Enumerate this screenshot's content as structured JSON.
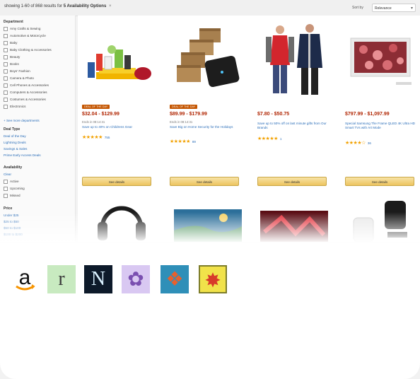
{
  "header": {
    "results_text": "showing 1-60 of 868 results for",
    "results_bold": "5 Availability Options",
    "sort_label": "Sort by",
    "sort_value": "Relevance"
  },
  "sidebar": {
    "department_heading": "Department",
    "departments": [
      "Amy Crafts & Sewing",
      "Automotive & Motorcycle",
      "Baby",
      "Baby Clothing & Accessories",
      "Beauty",
      "Books",
      "Boys' Fashion",
      "Camera & Photo",
      "Cell Phones & Accessories",
      "Computers & Accessories",
      "Costumes & Accessories",
      "Electronics"
    ],
    "see_more": "+ See more departments",
    "deal_type_heading": "Deal Type",
    "deal_types": [
      "Deal of the Day",
      "Lightning Deals",
      "Savings & Sales",
      "Prime Early Access Deals"
    ],
    "availability_heading": "Availability",
    "availability_clear": "Clear",
    "availability": [
      "Active",
      "Upcoming",
      "Missed"
    ],
    "price_heading": "Price",
    "prices": [
      "Under $25",
      "$25 to $50",
      "$50 to $100",
      "$100 to $200"
    ]
  },
  "products": [
    {
      "badge": "DEAL OF THE DAY",
      "price": "$32.04 - $129.99",
      "sub": "Ends in 08:14:31",
      "title": "Save up to 40% on Childrens Gear",
      "stars": "★★★★★",
      "rating_count": "755",
      "button": "See details"
    },
    {
      "badge": "DEAL OF THE DAY",
      "price": "$89.99 - $179.99",
      "sub": "Ends in 08:14:31",
      "title": "Save Big on Home Security for the Holidays",
      "stars": "★★★★★",
      "rating_count": "89",
      "button": "See details"
    },
    {
      "badge": "",
      "price": "$7.80 - $50.75",
      "sub": "",
      "title": "Save up to 50% off on last minute gifts from Our Brands",
      "stars": "★★★★★",
      "rating_count": "1",
      "button": "See details"
    },
    {
      "badge": "",
      "price": "$797.99 - $1,097.99",
      "sub": "",
      "title": "Special Samsung The Frame QLED 4K Ultra HD Smart TVs with Art Mode",
      "stars": "★★★★☆",
      "rating_count": "36",
      "button": "See details"
    }
  ],
  "bottom_apps": [
    {
      "name": "amazon",
      "glyph": "a",
      "bg": "#ffffff",
      "fg": "#111111"
    },
    {
      "name": "r",
      "glyph": "r",
      "bg": "#c8eac0",
      "fg": "#3a3a3a"
    },
    {
      "name": "N",
      "glyph": "N",
      "bg": "#0d1a2a",
      "fg": "#d9f1ff"
    },
    {
      "name": "lotus",
      "glyph": "✿",
      "bg": "#d9c8f2",
      "fg": "#7a4fb0"
    },
    {
      "name": "cluster",
      "glyph": "❖",
      "bg": "#2f8fb8",
      "fg": "#e8602c"
    },
    {
      "name": "starburst",
      "glyph": "✸",
      "bg": "#f1e24a",
      "fg": "#d83a2a"
    }
  ],
  "colors": {
    "price_red": "#b12704",
    "link_blue": "#2a6db8",
    "button_gold": "#edc45f",
    "badge_orange": "#c45500"
  }
}
